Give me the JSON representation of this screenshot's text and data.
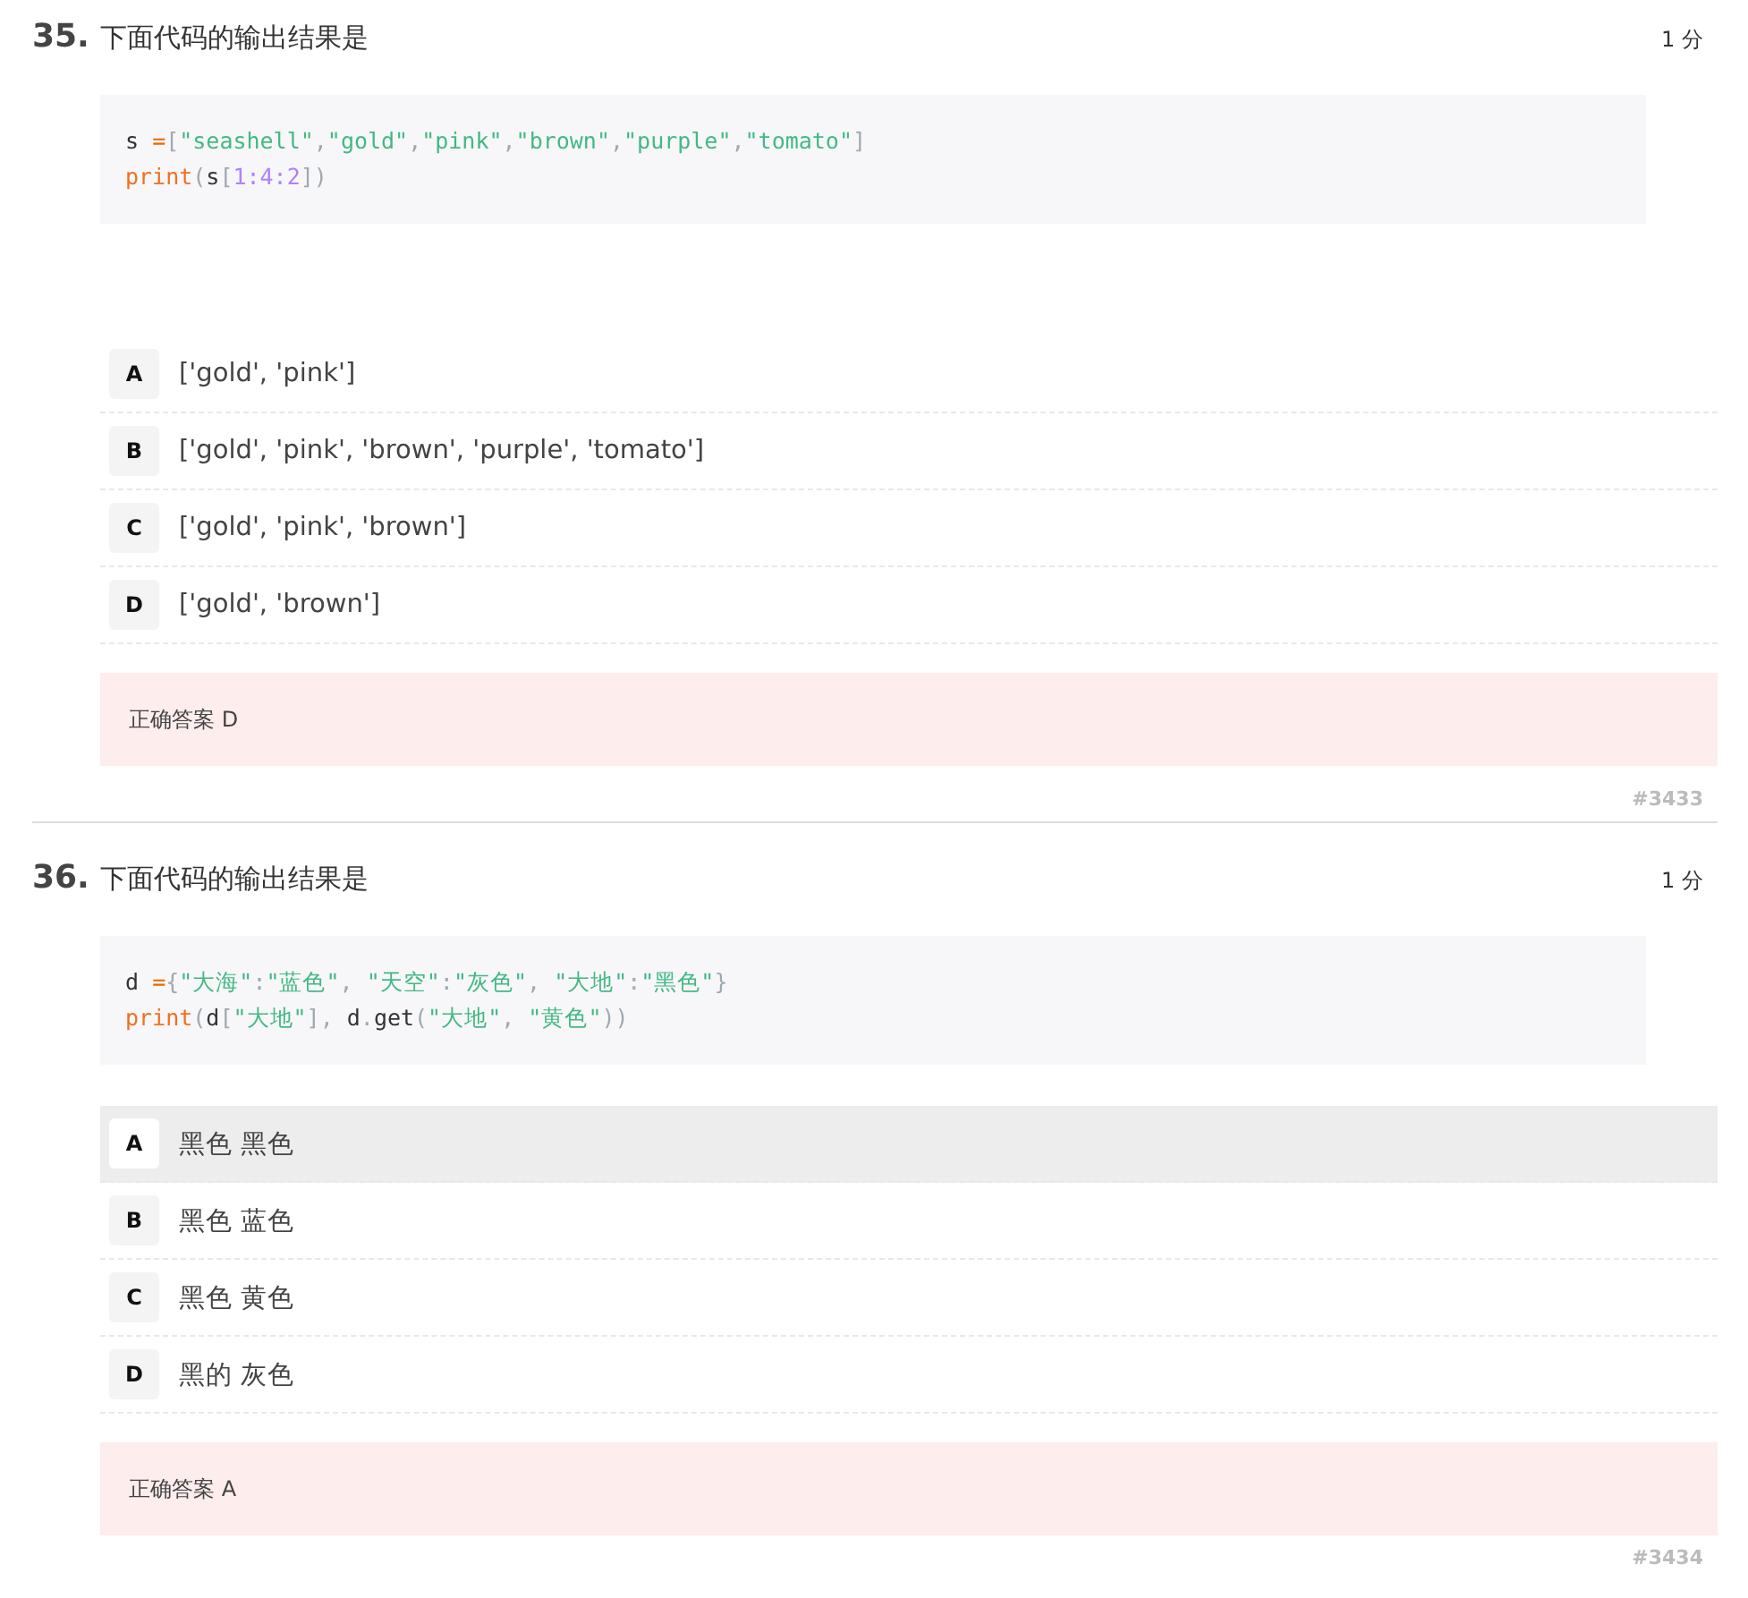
{
  "questions": [
    {
      "number": "35.",
      "text": "下面代码的输出结果是",
      "score": "1 分",
      "code": [
        [
          {
            "kind": "plain",
            "t": "s "
          },
          {
            "kind": "op",
            "t": "="
          },
          {
            "kind": "punct",
            "t": "["
          },
          {
            "kind": "string",
            "t": "\"seashell\""
          },
          {
            "kind": "punct",
            "t": ","
          },
          {
            "kind": "string",
            "t": "\"gold\""
          },
          {
            "kind": "punct",
            "t": ","
          },
          {
            "kind": "string",
            "t": "\"pink\""
          },
          {
            "kind": "punct",
            "t": ","
          },
          {
            "kind": "string",
            "t": "\"brown\""
          },
          {
            "kind": "punct",
            "t": ","
          },
          {
            "kind": "string",
            "t": "\"purple\""
          },
          {
            "kind": "punct",
            "t": ","
          },
          {
            "kind": "string",
            "t": "\"tomato\""
          },
          {
            "kind": "punct",
            "t": "]"
          }
        ],
        [
          {
            "kind": "func",
            "t": "print"
          },
          {
            "kind": "punct",
            "t": "("
          },
          {
            "kind": "plain",
            "t": "s"
          },
          {
            "kind": "punct",
            "t": "["
          },
          {
            "kind": "number",
            "t": "1:4:2"
          },
          {
            "kind": "punct",
            "t": "])"
          }
        ]
      ],
      "options": [
        {
          "letter": "A",
          "text": "['gold', 'pink']",
          "selected": false
        },
        {
          "letter": "B",
          "text": "['gold', 'pink', 'brown', 'purple', 'tomato']",
          "selected": false
        },
        {
          "letter": "C",
          "text": "['gold', 'pink', 'brown']",
          "selected": false
        },
        {
          "letter": "D",
          "text": "['gold', 'brown']",
          "selected": false
        }
      ],
      "answer": "正确答案 D",
      "id": "#3433"
    },
    {
      "number": "36.",
      "text": "下面代码的输出结果是",
      "score": "1 分",
      "code": [
        [
          {
            "kind": "plain",
            "t": "d "
          },
          {
            "kind": "op",
            "t": "="
          },
          {
            "kind": "punct",
            "t": "{"
          },
          {
            "kind": "string",
            "t": "\"大海\""
          },
          {
            "kind": "punct",
            "t": ":"
          },
          {
            "kind": "string",
            "t": "\"蓝色\""
          },
          {
            "kind": "punct",
            "t": ", "
          },
          {
            "kind": "string",
            "t": "\"天空\""
          },
          {
            "kind": "punct",
            "t": ":"
          },
          {
            "kind": "string",
            "t": "\"灰色\""
          },
          {
            "kind": "punct",
            "t": ", "
          },
          {
            "kind": "string",
            "t": "\"大地\""
          },
          {
            "kind": "punct",
            "t": ":"
          },
          {
            "kind": "string",
            "t": "\"黑色\""
          },
          {
            "kind": "punct",
            "t": "}"
          }
        ],
        [
          {
            "kind": "func",
            "t": "print"
          },
          {
            "kind": "punct",
            "t": "("
          },
          {
            "kind": "plain",
            "t": "d"
          },
          {
            "kind": "punct",
            "t": "["
          },
          {
            "kind": "string",
            "t": "\"大地\""
          },
          {
            "kind": "punct",
            "t": "], "
          },
          {
            "kind": "plain",
            "t": "d"
          },
          {
            "kind": "punct",
            "t": "."
          },
          {
            "kind": "plain",
            "t": "get"
          },
          {
            "kind": "punct",
            "t": "("
          },
          {
            "kind": "string",
            "t": "\"大地\""
          },
          {
            "kind": "punct",
            "t": ", "
          },
          {
            "kind": "string",
            "t": "\"黄色\""
          },
          {
            "kind": "punct",
            "t": "))"
          }
        ]
      ],
      "options": [
        {
          "letter": "A",
          "text": "黑色 黑色",
          "selected": true
        },
        {
          "letter": "B",
          "text": "黑色 蓝色",
          "selected": false
        },
        {
          "letter": "C",
          "text": "黑色 黄色",
          "selected": false
        },
        {
          "letter": "D",
          "text": "黑的 灰色",
          "selected": false
        }
      ],
      "answer": "正确答案 A",
      "id": "#3434"
    }
  ]
}
